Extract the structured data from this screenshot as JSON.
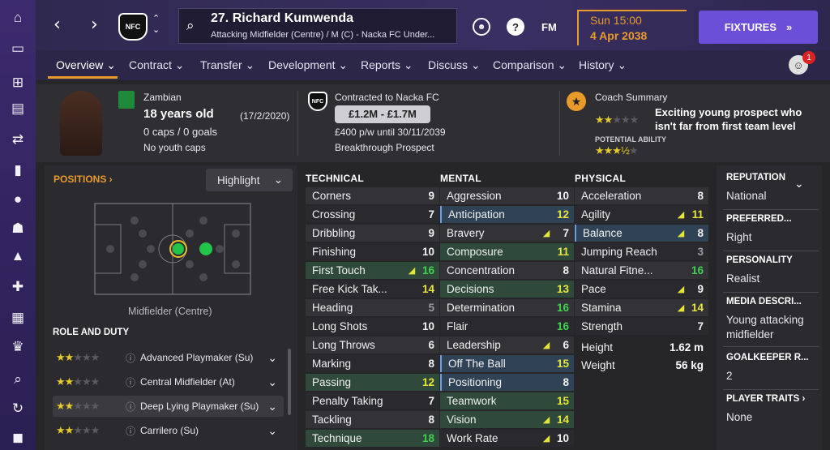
{
  "header": {
    "player_title": "27. Richard Kumwenda",
    "subtitle": "Attacking Midfielder (Centre) / M (C) - Nacka FC Under...",
    "time": "Sun 15:00",
    "date": "4 Apr 2038",
    "fixtures_label": "FIXTURES",
    "club_crest": "NFC",
    "fm_label": "FM",
    "notification_count": "1",
    "accent": "#e89a2a"
  },
  "tabs": [
    "Overview",
    "Contract",
    "Transfer",
    "Development",
    "Reports",
    "Discuss",
    "Comparison",
    "History"
  ],
  "profile": {
    "nationality": "Zambian",
    "age": "18 years old",
    "dob": "(17/2/2020)",
    "caps": "0 caps / 0 goals",
    "youth": "No youth caps",
    "contract_club": "Contracted to Nacka FC",
    "value": "£1.2M - £1.7M",
    "wage": "£400 p/w until 30/11/2039",
    "prospect": "Breakthrough Prospect",
    "coach_label": "Coach Summary",
    "coach_text": "Exciting young prospect who isn't far from first team level",
    "potential_label": "POTENTIAL ABILITY",
    "current_stars": 2,
    "potential_stars": 3.5
  },
  "positions": {
    "title": "POSITIONS",
    "highlight": "Highlight",
    "position_label": "Midfielder (Centre)",
    "role_title": "ROLE AND DUTY"
  },
  "roles": [
    {
      "name": "Advanced Playmaker (Su)",
      "stars": 2
    },
    {
      "name": "Central Midfielder (At)",
      "stars": 2
    },
    {
      "name": "Deep Lying Playmaker (Su)",
      "stars": 2
    },
    {
      "name": "Carrilero (Su)",
      "stars": 2
    }
  ],
  "technical": {
    "title": "TECHNICAL",
    "rows": [
      [
        "Corners",
        "9",
        ""
      ],
      [
        "Crossing",
        "7",
        ""
      ],
      [
        "Dribbling",
        "9",
        ""
      ],
      [
        "Finishing",
        "10",
        ""
      ],
      [
        "First Touch",
        "16",
        "up"
      ],
      [
        "Free Kick Tak...",
        "14",
        ""
      ],
      [
        "Heading",
        "5",
        ""
      ],
      [
        "Long Shots",
        "10",
        ""
      ],
      [
        "Long Throws",
        "6",
        ""
      ],
      [
        "Marking",
        "8",
        ""
      ],
      [
        "Passing",
        "12",
        ""
      ],
      [
        "Penalty Taking",
        "7",
        ""
      ],
      [
        "Tackling",
        "8",
        ""
      ],
      [
        "Technique",
        "18",
        ""
      ]
    ]
  },
  "mental": {
    "title": "MENTAL",
    "rows": [
      [
        "Aggression",
        "10",
        ""
      ],
      [
        "Anticipation",
        "12",
        ""
      ],
      [
        "Bravery",
        "7",
        "up"
      ],
      [
        "Composure",
        "11",
        ""
      ],
      [
        "Concentration",
        "8",
        ""
      ],
      [
        "Decisions",
        "13",
        ""
      ],
      [
        "Determination",
        "16",
        ""
      ],
      [
        "Flair",
        "16",
        ""
      ],
      [
        "Leadership",
        "6",
        "up"
      ],
      [
        "Off The Ball",
        "15",
        ""
      ],
      [
        "Positioning",
        "8",
        ""
      ],
      [
        "Teamwork",
        "15",
        ""
      ],
      [
        "Vision",
        "14",
        "up"
      ],
      [
        "Work Rate",
        "10",
        "up"
      ]
    ]
  },
  "physical": {
    "title": "PHYSICAL",
    "rows": [
      [
        "Acceleration",
        "8",
        ""
      ],
      [
        "Agility",
        "11",
        "up"
      ],
      [
        "Balance",
        "8",
        "up"
      ],
      [
        "Jumping Reach",
        "3",
        ""
      ],
      [
        "Natural Fitne...",
        "16",
        ""
      ],
      [
        "Pace",
        "9",
        "up"
      ],
      [
        "Stamina",
        "14",
        "up"
      ],
      [
        "Strength",
        "7",
        ""
      ]
    ],
    "height_label": "Height",
    "height": "1.62 m",
    "weight_label": "Weight",
    "weight": "56 kg"
  },
  "right": [
    {
      "h": "REPUTATION",
      "v": "National"
    },
    {
      "h": "PREFERRED...",
      "v": "Right"
    },
    {
      "h": "PERSONALITY",
      "v": "Realist"
    },
    {
      "h": "MEDIA DESCRI...",
      "v": "Young attacking midfielder"
    },
    {
      "h": "GOALKEEPER R...",
      "v": "2"
    },
    {
      "h": "PLAYER TRAITS",
      "v": "None"
    }
  ]
}
